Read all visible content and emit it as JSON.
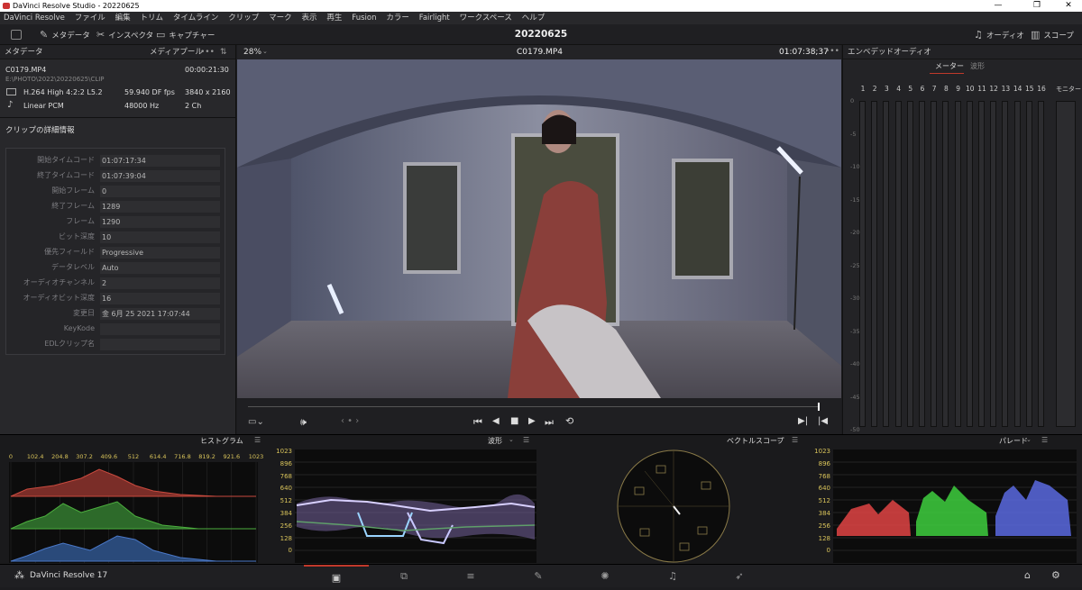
{
  "window": {
    "title": "DaVinci Resolve Studio - 20220625",
    "min": "—",
    "max": "❐",
    "close": "✕"
  },
  "menu": [
    "DaVinci Resolve",
    "ファイル",
    "編集",
    "トリム",
    "タイムライン",
    "クリップ",
    "マーク",
    "表示",
    "再生",
    "Fusion",
    "カラー",
    "Fairlight",
    "ワークスペース",
    "ヘルプ"
  ],
  "toolbar": {
    "metadata": "メタデータ",
    "inspector": "インスペクタ",
    "capture": "キャプチャー",
    "project": "20220625",
    "audio": "オーディオ",
    "scope": "スコープ"
  },
  "left": {
    "header": "メタデータ",
    "pool": "メディアプール",
    "clip": {
      "name": "C0179.MP4",
      "duration": "00:00:21:30",
      "path": "E:\\PHOTO\\2022\\20220625\\CLIP",
      "codec": "H.264 High 4:2:2 L5.2",
      "fps": "59.940 DF fps",
      "res": "3840 x 2160",
      "audio_codec": "Linear PCM",
      "rate": "48000 Hz",
      "chans": "2 Ch"
    },
    "details_title": "クリップの詳細情報",
    "details": [
      {
        "label": "開始タイムコード",
        "value": "01:07:17:34"
      },
      {
        "label": "終了タイムコード",
        "value": "01:07:39:04"
      },
      {
        "label": "開始フレーム",
        "value": "0"
      },
      {
        "label": "終了フレーム",
        "value": "1289"
      },
      {
        "label": "フレーム",
        "value": "1290"
      },
      {
        "label": "ビット深度",
        "value": "10"
      },
      {
        "label": "優先フィールド",
        "value": "Progressive"
      },
      {
        "label": "データレベル",
        "value": "Auto"
      },
      {
        "label": "オーディオチャンネル",
        "value": "2"
      },
      {
        "label": "オーディオビット深度",
        "value": "16"
      },
      {
        "label": "変更日",
        "value": "金 6月 25 2021 17:07:44"
      },
      {
        "label": "KeyKode",
        "value": ""
      },
      {
        "label": "EDLクリップ名",
        "value": ""
      }
    ]
  },
  "viewer": {
    "zoom": "28%",
    "clip": "C0179.MP4",
    "timecode": "01:07:38;37"
  },
  "audio": {
    "title": "エンベデッドオーディオ",
    "tab_meter": "メーター",
    "tab_wave": "波形",
    "monitor": "モニター",
    "channels": [
      "1",
      "2",
      "3",
      "4",
      "5",
      "6",
      "7",
      "8",
      "9",
      "10",
      "11",
      "12",
      "13",
      "14",
      "15",
      "16"
    ],
    "db": [
      "0",
      "-5",
      "-10",
      "-15",
      "-20",
      "-25",
      "-30",
      "-35",
      "-40",
      "-45",
      "-50"
    ]
  },
  "scopes": {
    "histogram": {
      "title": "ヒストグラム",
      "ticks": [
        "0",
        "102.4",
        "204.8",
        "307.2",
        "409.6",
        "512",
        "614.4",
        "716.8",
        "819.2",
        "921.6",
        "1023"
      ]
    },
    "waveform": {
      "title": "波形"
    },
    "vectorscope": {
      "title": "ベクトルスコープ"
    },
    "parade": {
      "title": "パレード"
    },
    "levels": [
      "1023",
      "896",
      "768",
      "640",
      "512",
      "384",
      "256",
      "128",
      "0"
    ]
  },
  "footer": {
    "app": "DaVinci Resolve 17"
  }
}
